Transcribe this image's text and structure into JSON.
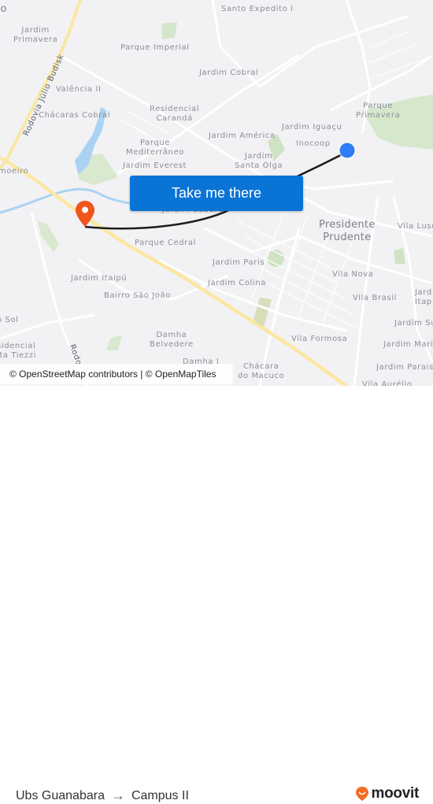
{
  "map": {
    "labels": {
      "do": "do",
      "jardim_primavera": "Jardim\nPrimavera",
      "santo_expedito": "Santo Expedito I",
      "parque_imperial": "Parque Imperial",
      "jardim_cobral": "Jardim Cobral",
      "valencia": "Valência II",
      "chacaras_cobral": "Chácaras Cobral",
      "residencial_caranda": "Residencial\nCarandá",
      "parque_primavera": "Parque\nPrimavera",
      "jardim_iguacu": "Jardim Iguaçu",
      "jardim_america": "Jardim América",
      "inocoop": "Inocoop",
      "parque_mediterraneo": "Parque\nMediterrâneo",
      "jardim_everest": "Jardim Everest",
      "jardim_santa_olga": "Jardim\nSanta Olga",
      "moeiro": "moeiro",
      "jardim_sabara": "Jardim Sabará",
      "presidente_prudente": "Presidente\nPrudente",
      "vila_luso": "Vila Luso",
      "parque_cedral": "Parque Cedral",
      "jardim_paris": "Jardim Paris",
      "jardim_colina": "Jardim Colina",
      "vila_nova": "Vila Nova",
      "jardim_itaipu": "Jardim Itaipú",
      "bairro_sao_joao": "Bairro São João",
      "vila_brasil": "Vila Brasil",
      "jardim_itap": "Jard\nItap",
      "o_sol": "o Sol",
      "jardim_su": "Jardim Su",
      "damha_belvedere": "Damha\nBelvedere",
      "vila_formosa": "Vila Formosa",
      "jardim_mari": "Jardim Mari",
      "residencial_tiezzi": "sidencial\nita Tiezzi",
      "damha_i": "Damha I",
      "chacara_macuco": "Chácara\ndo Macuco",
      "jardim_parais": "Jardim Parais",
      "vila_aurelio": "Vila Aurélio",
      "rodovia_julio_budisk": "Rodovia Júlio Budisk",
      "rodo": "Rodo"
    },
    "take_me_there": "Take me there",
    "attribution": "© OpenStreetMap contributors | © OpenMapTiles",
    "colors": {
      "origin_marker": "#2f7df6",
      "destination_marker": "#f0551c",
      "route_line": "#1d1d1f",
      "cta_background": "#0a73d6",
      "highway": "#fbe7a1",
      "water": "#aad3f2",
      "park": "#cfe3c4"
    }
  },
  "footer": {
    "origin": "Ubs Guanabara",
    "arrow": "→",
    "destination": "Campus II",
    "brand": "moovit",
    "brand_color": "#f26c21"
  }
}
